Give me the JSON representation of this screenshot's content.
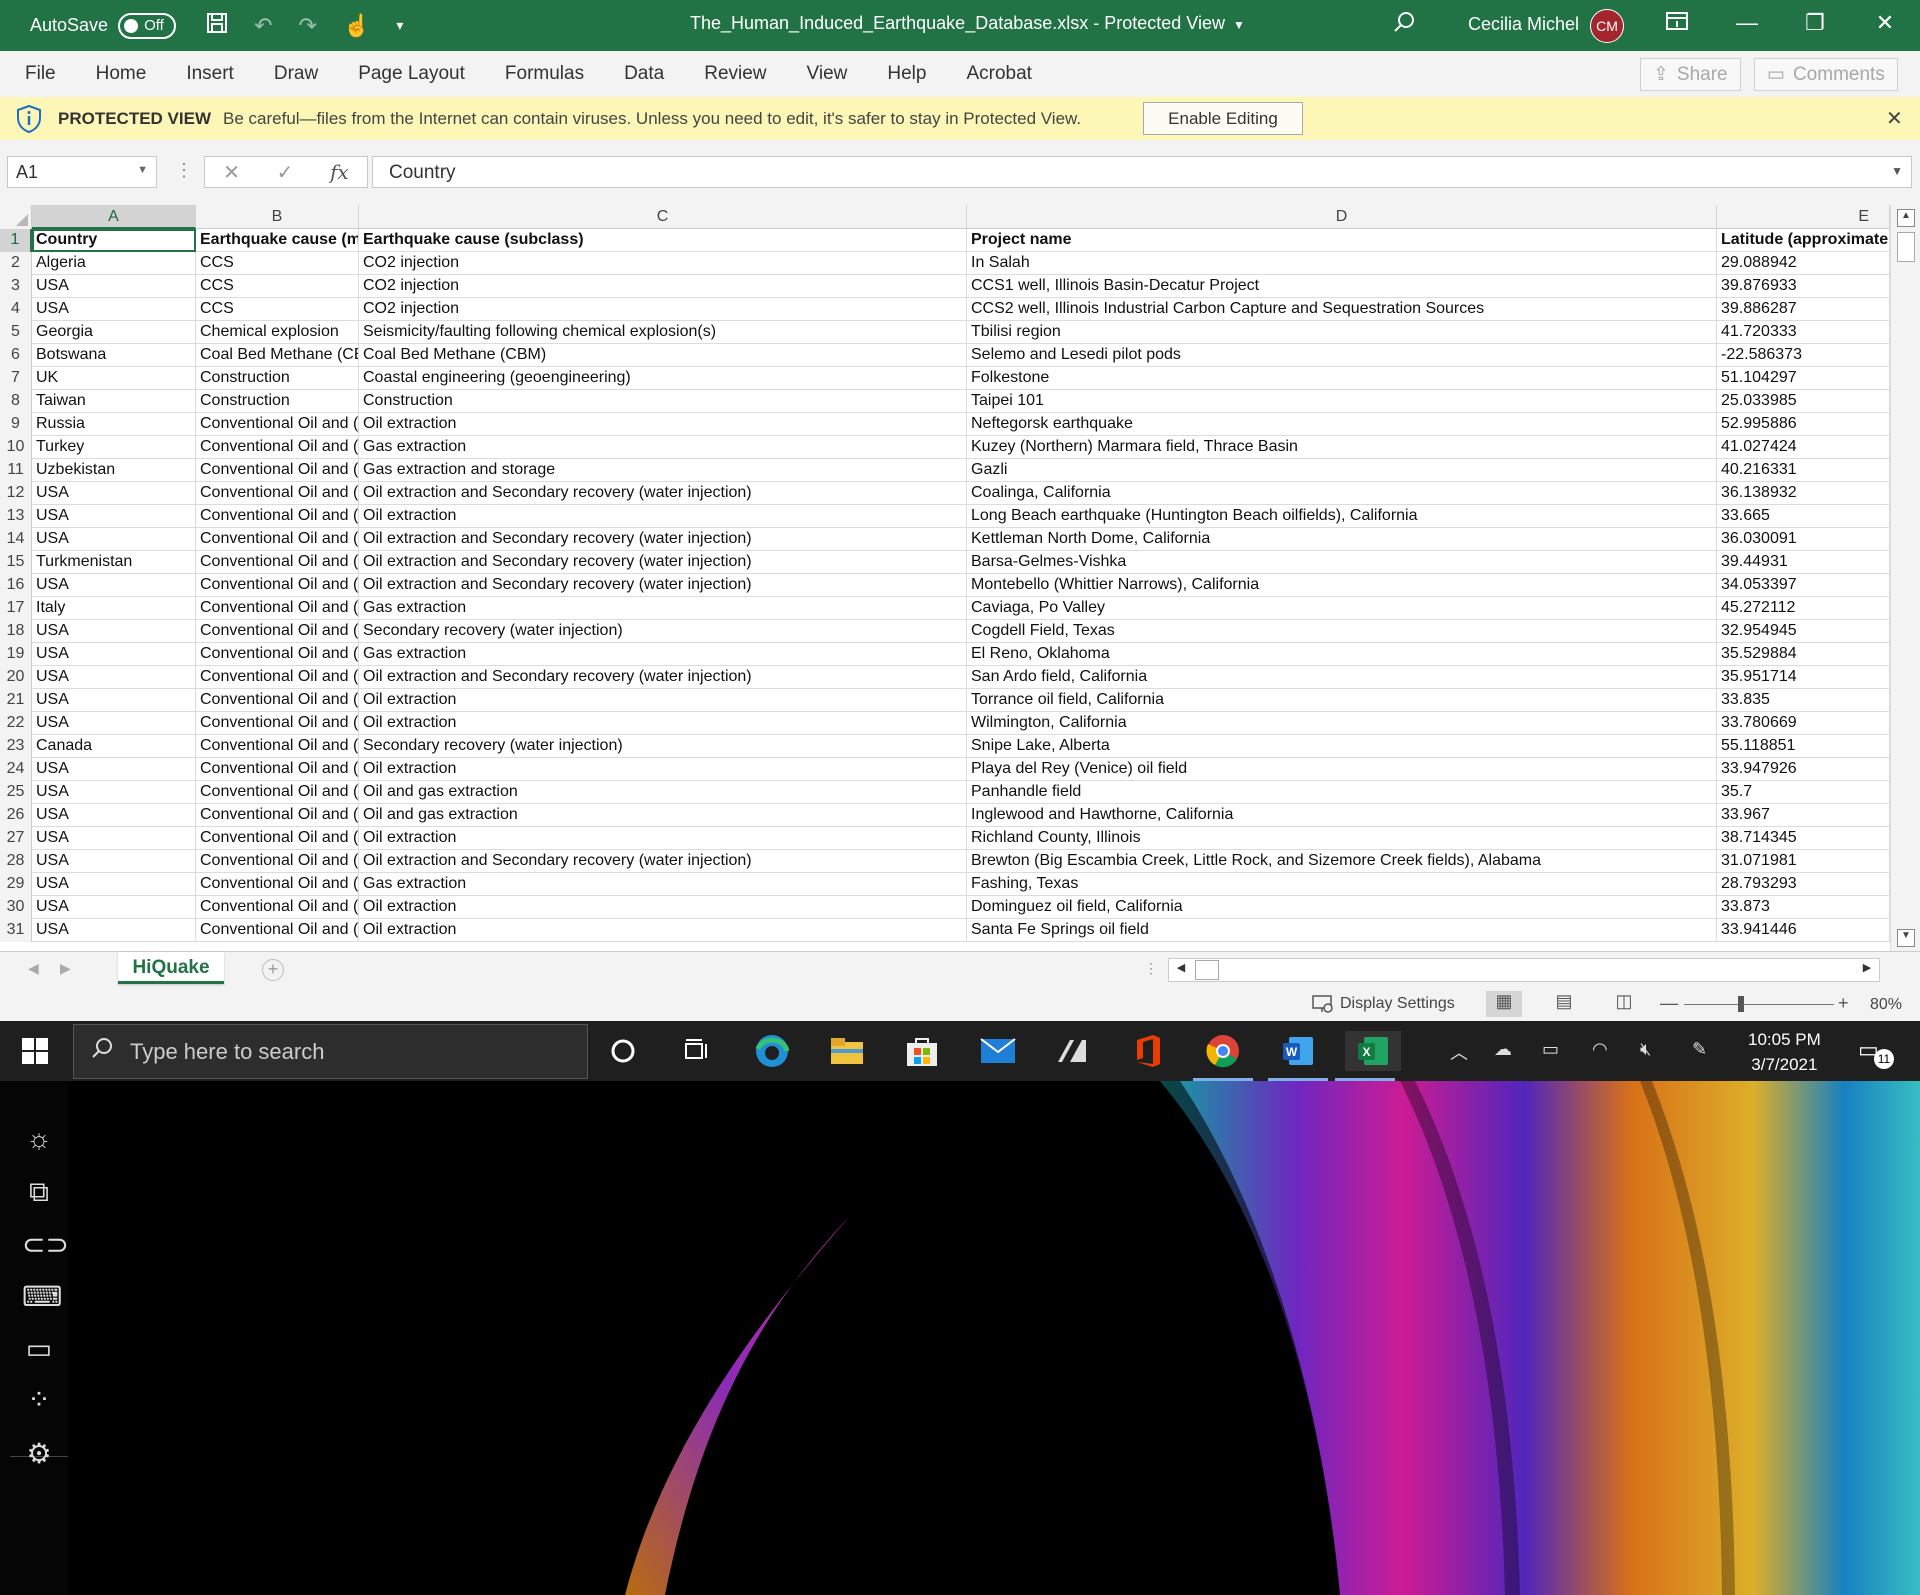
{
  "titlebar": {
    "autosave_label": "AutoSave",
    "autosave_state": "Off",
    "doc_title": "The_Human_Induced_Earthquake_Database.xlsx  -  Protected View",
    "user_name": "Cecilia Michel",
    "user_initials": "CM",
    "accent_color": "#217346"
  },
  "ribbon": {
    "tabs": [
      "File",
      "Home",
      "Insert",
      "Draw",
      "Page Layout",
      "Formulas",
      "Data",
      "Review",
      "View",
      "Help",
      "Acrobat"
    ],
    "share_label": "Share",
    "comments_label": "Comments"
  },
  "protected_view": {
    "title": "PROTECTED VIEW",
    "message": "Be careful—files from the Internet can contain viruses. Unless you need to edit, it's safer to stay in Protected View.",
    "enable_label": "Enable Editing"
  },
  "formula_bar": {
    "name_box": "A1",
    "fx_label": "fx",
    "value": "Country"
  },
  "grid": {
    "columns": [
      "A",
      "B",
      "C",
      "D",
      "E"
    ],
    "header_row": {
      "num": "1",
      "a": "Country",
      "b": "Earthquake cause (m",
      "c": "Earthquake cause (subclass)",
      "d": "Project name",
      "e": "Latitude (approximate"
    },
    "rows": [
      {
        "num": "2",
        "a": "Algeria",
        "b": "CCS",
        "c": "CO2 injection",
        "d": "In Salah",
        "e": "29.088942"
      },
      {
        "num": "3",
        "a": "USA",
        "b": "CCS",
        "c": "CO2 injection",
        "d": "CCS1 well, Illinois Basin-Decatur Project",
        "e": "39.876933"
      },
      {
        "num": "4",
        "a": "USA",
        "b": "CCS",
        "c": "CO2 injection",
        "d": "CCS2 well, Illinois Industrial Carbon Capture and Sequestration Sources",
        "e": "39.886287"
      },
      {
        "num": "5",
        "a": "Georgia",
        "b": "Chemical explosion",
        "c": "Seismicity/faulting following chemical explosion(s)",
        "d": "Tbilisi region",
        "e": "41.720333"
      },
      {
        "num": "6",
        "a": "Botswana",
        "b": "Coal Bed Methane (CE",
        "c": "Coal Bed Methane (CBM)",
        "d": "Selemo and Lesedi pilot pods",
        "e": "-22.586373"
      },
      {
        "num": "7",
        "a": "UK",
        "b": "Construction",
        "c": "Coastal engineering (geoengineering)",
        "d": "Folkestone",
        "e": "51.104297"
      },
      {
        "num": "8",
        "a": "Taiwan",
        "b": "Construction",
        "c": "Construction",
        "d": "Taipei 101",
        "e": "25.033985"
      },
      {
        "num": "9",
        "a": "Russia",
        "b": "Conventional Oil and (",
        "c": "Oil extraction",
        "d": "Neftegorsk earthquake",
        "e": "52.995886"
      },
      {
        "num": "10",
        "a": "Turkey",
        "b": "Conventional Oil and (",
        "c": "Gas extraction",
        "d": "Kuzey (Northern) Marmara field, Thrace Basin",
        "e": "41.027424"
      },
      {
        "num": "11",
        "a": "Uzbekistan",
        "b": "Conventional Oil and (",
        "c": "Gas extraction and storage",
        "d": "Gazli",
        "e": "40.216331"
      },
      {
        "num": "12",
        "a": "USA",
        "b": "Conventional Oil and (",
        "c": "Oil extraction and Secondary recovery (water injection)",
        "d": "Coalinga, California",
        "e": "36.138932"
      },
      {
        "num": "13",
        "a": "USA",
        "b": "Conventional Oil and (",
        "c": "Oil extraction",
        "d": "Long Beach earthquake (Huntington Beach oilfields), California",
        "e": "33.665"
      },
      {
        "num": "14",
        "a": "USA",
        "b": "Conventional Oil and (",
        "c": "Oil extraction and Secondary recovery (water injection)",
        "d": "Kettleman North Dome, California",
        "e": "36.030091"
      },
      {
        "num": "15",
        "a": "Turkmenistan",
        "b": "Conventional Oil and (",
        "c": "Oil extraction and Secondary recovery (water injection)",
        "d": "Barsa-Gelmes-Vishka",
        "e": "39.44931"
      },
      {
        "num": "16",
        "a": "USA",
        "b": "Conventional Oil and (",
        "c": "Oil extraction and Secondary recovery (water injection)",
        "d": "Montebello (Whittier Narrows), California",
        "e": "34.053397"
      },
      {
        "num": "17",
        "a": "Italy",
        "b": "Conventional Oil and (",
        "c": "Gas extraction",
        "d": "Caviaga, Po Valley",
        "e": "45.272112"
      },
      {
        "num": "18",
        "a": "USA",
        "b": "Conventional Oil and (",
        "c": "Secondary recovery (water injection)",
        "d": "Cogdell Field, Texas",
        "e": "32.954945"
      },
      {
        "num": "19",
        "a": "USA",
        "b": "Conventional Oil and (",
        "c": "Gas extraction",
        "d": "El Reno, Oklahoma",
        "e": "35.529884"
      },
      {
        "num": "20",
        "a": "USA",
        "b": "Conventional Oil and (",
        "c": "Oil extraction and Secondary recovery (water injection)",
        "d": "San Ardo field, California",
        "e": "35.951714"
      },
      {
        "num": "21",
        "a": "USA",
        "b": "Conventional Oil and (",
        "c": "Oil extraction",
        "d": "Torrance oil field, California",
        "e": "33.835"
      },
      {
        "num": "22",
        "a": "USA",
        "b": "Conventional Oil and (",
        "c": "Oil extraction",
        "d": "Wilmington, California",
        "e": "33.780669"
      },
      {
        "num": "23",
        "a": "Canada",
        "b": "Conventional Oil and (",
        "c": "Secondary recovery (water injection)",
        "d": "Snipe Lake, Alberta",
        "e": "55.118851"
      },
      {
        "num": "24",
        "a": "USA",
        "b": "Conventional Oil and (",
        "c": "Oil extraction",
        "d": "Playa del Rey (Venice) oil field",
        "e": "33.947926"
      },
      {
        "num": "25",
        "a": "USA",
        "b": "Conventional Oil and (",
        "c": "Oil and gas extraction",
        "d": "Panhandle field",
        "e": "35.7"
      },
      {
        "num": "26",
        "a": "USA",
        "b": "Conventional Oil and (",
        "c": "Oil and gas extraction",
        "d": "Inglewood and Hawthorne, California",
        "e": "33.967"
      },
      {
        "num": "27",
        "a": "USA",
        "b": "Conventional Oil and (",
        "c": "Oil extraction",
        "d": "Richland County, Illinois",
        "e": "38.714345"
      },
      {
        "num": "28",
        "a": "USA",
        "b": "Conventional Oil and (",
        "c": "Oil extraction and Secondary recovery (water injection)",
        "d": "Brewton (Big Escambia Creek, Little Rock, and Sizemore Creek fields), Alabama",
        "e": "31.071981"
      },
      {
        "num": "29",
        "a": "USA",
        "b": "Conventional Oil and (",
        "c": "Gas extraction",
        "d": "Fashing, Texas",
        "e": "28.793293"
      },
      {
        "num": "30",
        "a": "USA",
        "b": "Conventional Oil and (",
        "c": "Oil extraction",
        "d": "Dominguez oil field, California",
        "e": "33.873"
      },
      {
        "num": "31",
        "a": "USA",
        "b": "Conventional Oil and (",
        "c": "Oil extraction",
        "d": "Santa Fe Springs oil field",
        "e": "33.941446"
      }
    ]
  },
  "sheet_tabs": {
    "active": "HiQuake",
    "add_label": "+"
  },
  "statusbar": {
    "display_settings": "Display Settings",
    "zoom_percent": "80%",
    "zoom_level": 0.8
  },
  "taskbar": {
    "search_placeholder": "Type here to search",
    "time": "10:05 PM",
    "date": "3/7/2021",
    "notification_count": "11",
    "apps": [
      "cortana-icon",
      "task-view-icon",
      "edge-icon",
      "file-explorer-icon",
      "store-icon",
      "mail-icon",
      "app-icon",
      "office-icon",
      "chrome-icon",
      "word-icon",
      "excel-icon"
    ]
  },
  "desktop_sidebar": {
    "icons": [
      "brightness-icon",
      "screen-capture-icon",
      "link-icon",
      "keyboard-icon",
      "laptop-icon",
      "apps-icon",
      "settings-icon"
    ]
  }
}
